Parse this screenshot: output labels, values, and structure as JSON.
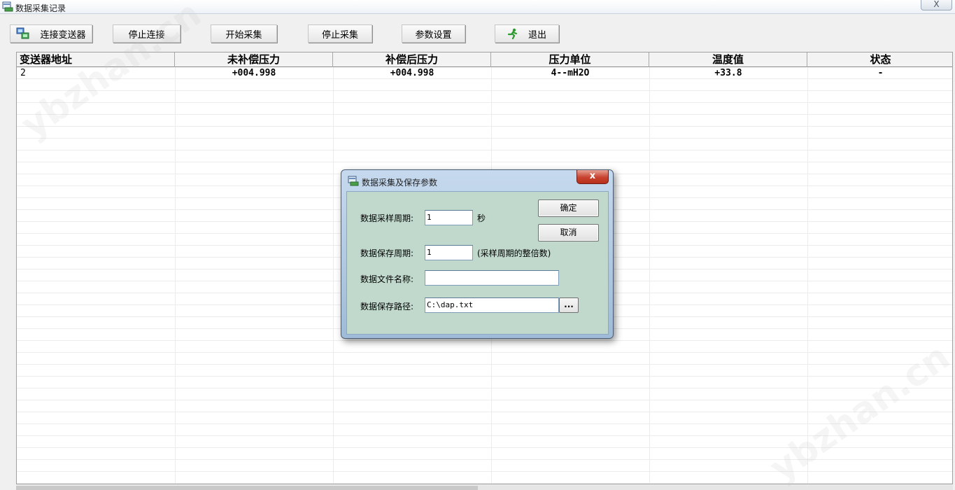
{
  "window": {
    "title": "数据采集记录",
    "close_glyph": "X"
  },
  "toolbar": {
    "connect_label": "连接变送器",
    "disconnect_label": "停止连接",
    "start_label": "开始采集",
    "stop_label": "停止采集",
    "settings_label": "参数设置",
    "exit_label": "退出"
  },
  "table": {
    "columns": [
      "变送器地址",
      "未补偿压力",
      "补偿后压力",
      "压力单位",
      "温度值",
      "状态"
    ],
    "rows": [
      [
        "2",
        "+004.998",
        "+004.998",
        "4--mH2O",
        "+33.8",
        "-"
      ]
    ]
  },
  "watermark": {
    "text": "ybzhan.cn"
  },
  "dialog": {
    "title": "数据采集及保存参数",
    "close_glyph": "x",
    "sample_period_label": "数据采样周期:",
    "sample_period_value": "1",
    "sample_period_unit": "秒",
    "save_period_label": "数据保存周期:",
    "save_period_value": "1",
    "save_period_hint": "(采样周期的整倍数)",
    "file_name_label": "数据文件名称:",
    "file_name_value": "",
    "save_path_label": "数据保存路径:",
    "save_path_value": "C:\\dap.txt",
    "browse_label": "...",
    "ok_label": "确定",
    "cancel_label": "取消"
  },
  "colors": {
    "dialog_body": "#c0d9cc",
    "dialog_close": "#c7432f",
    "grid_line": "#ececec"
  },
  "icons": {
    "app": "app-window-icon",
    "connect": "network-connect-icon",
    "exit": "running-man-exit-icon"
  }
}
